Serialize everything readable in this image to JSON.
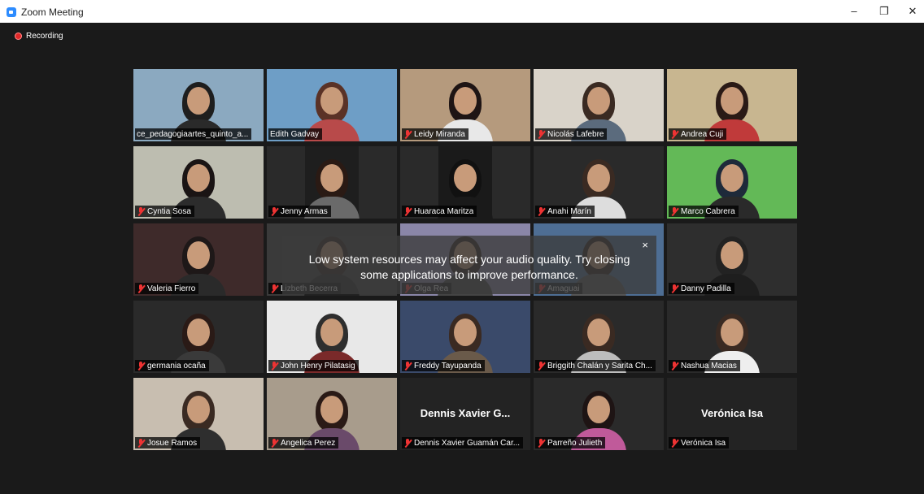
{
  "window": {
    "title": "Zoom Meeting"
  },
  "recording": {
    "label": "Recording"
  },
  "toast": {
    "text": "Low system resources may affect your audio quality. Try closing some applications to improve performance.",
    "close": "×"
  },
  "participants": [
    {
      "name": "ce_pedagogiaartes_quinto_a...",
      "muted": false,
      "active": true
    },
    {
      "name": "Edith Gadvay",
      "muted": false
    },
    {
      "name": "Leidy Miranda",
      "muted": true
    },
    {
      "name": "Nicolás Lafebre",
      "muted": true
    },
    {
      "name": "Andrea Cuji",
      "muted": true
    },
    {
      "name": "Cyntia  Sosa",
      "muted": true
    },
    {
      "name": "Jenny Armas",
      "muted": true
    },
    {
      "name": "Huaraca Maritza",
      "muted": true
    },
    {
      "name": "Anahi Marín",
      "muted": true
    },
    {
      "name": "Marco Cabrera",
      "muted": true
    },
    {
      "name": "Valeria Fierro",
      "muted": true
    },
    {
      "name": "Lizbeth Becerra",
      "muted": true
    },
    {
      "name": "Olga Rea",
      "muted": true
    },
    {
      "name": "Amaguai",
      "muted": true
    },
    {
      "name": "Danny Padilla",
      "muted": true
    },
    {
      "name": "germania ocaña",
      "muted": true
    },
    {
      "name": "John Henry Pilatasig",
      "muted": true
    },
    {
      "name": "Freddy Tayupanda",
      "muted": true
    },
    {
      "name": "Briggith Chalán y Sarita Ch...",
      "muted": true
    },
    {
      "name": "Nashua Macias",
      "muted": true
    },
    {
      "name": "Josue Ramos",
      "muted": true
    },
    {
      "name": "Angelica Perez",
      "muted": true
    },
    {
      "name": "Dennis Xavier Guamán Car...",
      "muted": true,
      "video_off": true,
      "display_name": "Dennis Xavier G..."
    },
    {
      "name": "Parreño Julieth",
      "muted": true
    },
    {
      "name": "Verónica Isa",
      "muted": true,
      "video_off": true,
      "display_name": "Verónica Isa"
    }
  ]
}
